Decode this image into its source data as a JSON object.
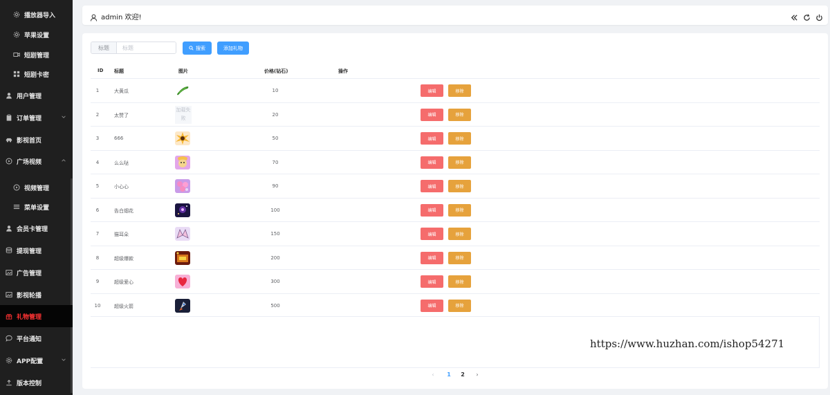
{
  "sidebar": {
    "items": [
      {
        "label": "播放器导入",
        "icon": "gear-icon",
        "sub": true
      },
      {
        "label": "苹果设置",
        "icon": "gear-icon",
        "sub": true
      },
      {
        "label": "短剧管理",
        "icon": "video-camera-icon",
        "sub": true
      },
      {
        "label": "短剧卡密",
        "icon": "grid-icon",
        "sub": true
      },
      {
        "label": "用户管理",
        "icon": "user-icon",
        "sub": false
      },
      {
        "label": "订单管理",
        "icon": "clipboard-icon",
        "sub": false,
        "arrow": "down"
      },
      {
        "label": "影视首页",
        "icon": "car-icon",
        "sub": false
      },
      {
        "label": "广场视频",
        "icon": "play-circle-icon",
        "sub": false,
        "arrow": "up"
      },
      {
        "label": "视频管理",
        "icon": "play-circle-icon",
        "sub": true
      },
      {
        "label": "菜单设置",
        "icon": "menu-lines-icon",
        "sub": true
      },
      {
        "label": "会员卡管理",
        "icon": "user-icon",
        "sub": false
      },
      {
        "label": "提现管理",
        "icon": "database-icon",
        "sub": false
      },
      {
        "label": "广告管理",
        "icon": "picture-icon",
        "sub": false
      },
      {
        "label": "影视轮播",
        "icon": "picture-icon",
        "sub": false
      },
      {
        "label": "礼物管理",
        "icon": "gift-icon",
        "sub": false,
        "active": true
      },
      {
        "label": "平台通知",
        "icon": "chat-icon",
        "sub": false
      },
      {
        "label": "APP配置",
        "icon": "gear-icon",
        "sub": false,
        "arrow": "down"
      },
      {
        "label": "版本控制",
        "icon": "upload-icon",
        "sub": false
      }
    ]
  },
  "header": {
    "welcome": "admin 欢迎!"
  },
  "search": {
    "prefix": "标题",
    "placeholder": "标题",
    "search_label": "搜索",
    "add_label": "添加礼物"
  },
  "table": {
    "columns": [
      "ID",
      "标题",
      "图片",
      "价格(钻石)",
      "操作"
    ],
    "edit_label": "编辑",
    "delete_label": "移除",
    "failed_text": "加载失败",
    "rows": [
      {
        "id": "1",
        "title": "大黄瓜",
        "price": "10",
        "image": "cucumber"
      },
      {
        "id": "2",
        "title": "太赞了",
        "price": "20",
        "image": "failed"
      },
      {
        "id": "3",
        "title": "666",
        "price": "50",
        "image": "burst"
      },
      {
        "id": "4",
        "title": "么么哒",
        "price": "70",
        "image": "cartoon"
      },
      {
        "id": "5",
        "title": "小心心",
        "price": "90",
        "image": "hearts"
      },
      {
        "id": "6",
        "title": "告白烟花",
        "price": "100",
        "image": "fireworks"
      },
      {
        "id": "7",
        "title": "猫耳朵",
        "price": "150",
        "image": "ears"
      },
      {
        "id": "8",
        "title": "超级爆款",
        "price": "200",
        "image": "gold"
      },
      {
        "id": "9",
        "title": "超级爱心",
        "price": "300",
        "image": "bigheart"
      },
      {
        "id": "10",
        "title": "超级火箭",
        "price": "500",
        "image": "rocket"
      }
    ]
  },
  "watermark": "https://www.huzhan.com/ishop54271",
  "pagination": {
    "prev": "‹",
    "pages": [
      "1",
      "2"
    ],
    "current": "1",
    "next": "›"
  },
  "colors": {
    "sidebar_bg": "#1f1f1f",
    "active_text": "#ff3333",
    "primary": "#409eff",
    "danger": "#f56c6c",
    "warning": "#e6a23c"
  }
}
